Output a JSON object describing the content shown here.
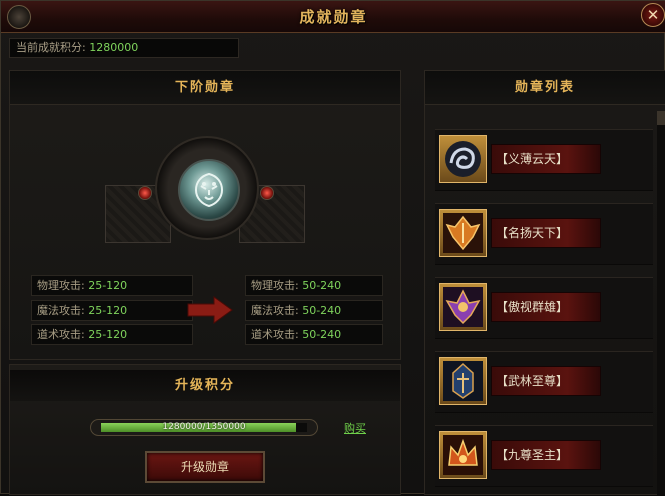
{
  "window": {
    "title": "成就勋章",
    "close_symbol": "✕"
  },
  "score": {
    "label": "当前成就积分:",
    "value": "1280000"
  },
  "left_panel": {
    "title": "下阶勋章",
    "medal_icon": "lion-medal-icon",
    "current_stats": [
      {
        "name": "物理攻击:",
        "value": "25-120"
      },
      {
        "name": "魔法攻击:",
        "value": "25-120"
      },
      {
        "name": "道术攻击:",
        "value": "25-120"
      }
    ],
    "next_stats": [
      {
        "name": "物理攻击:",
        "value": "50-240"
      },
      {
        "name": "魔法攻击:",
        "value": "50-240"
      },
      {
        "name": "道术攻击:",
        "value": "50-240"
      }
    ]
  },
  "upgrade": {
    "title": "升级积分",
    "progress_text": "1280000/1350000",
    "progress_current": 1280000,
    "progress_max": 1350000,
    "buy_label": "购买",
    "button_label": "升级勋章"
  },
  "right_panel": {
    "title": "勋章列表",
    "items": [
      {
        "name": "【义薄云天】",
        "icon": "swirl-medal-icon",
        "color": "#4a5a78"
      },
      {
        "name": "【名扬天下】",
        "icon": "phoenix-medal-icon",
        "color": "#b0611c"
      },
      {
        "name": "【傲视群雄】",
        "icon": "winged-medal-icon",
        "color": "#7b3c9a"
      },
      {
        "name": "【武林至尊】",
        "icon": "helmet-medal-icon",
        "color": "#2d5a9a"
      },
      {
        "name": "【九尊圣主】",
        "icon": "crown-medal-icon",
        "color": "#c8541a"
      }
    ]
  },
  "colors": {
    "accent_gold": "#e5b559",
    "value_green": "#7fd35c",
    "dark_red": "#5a130f"
  }
}
